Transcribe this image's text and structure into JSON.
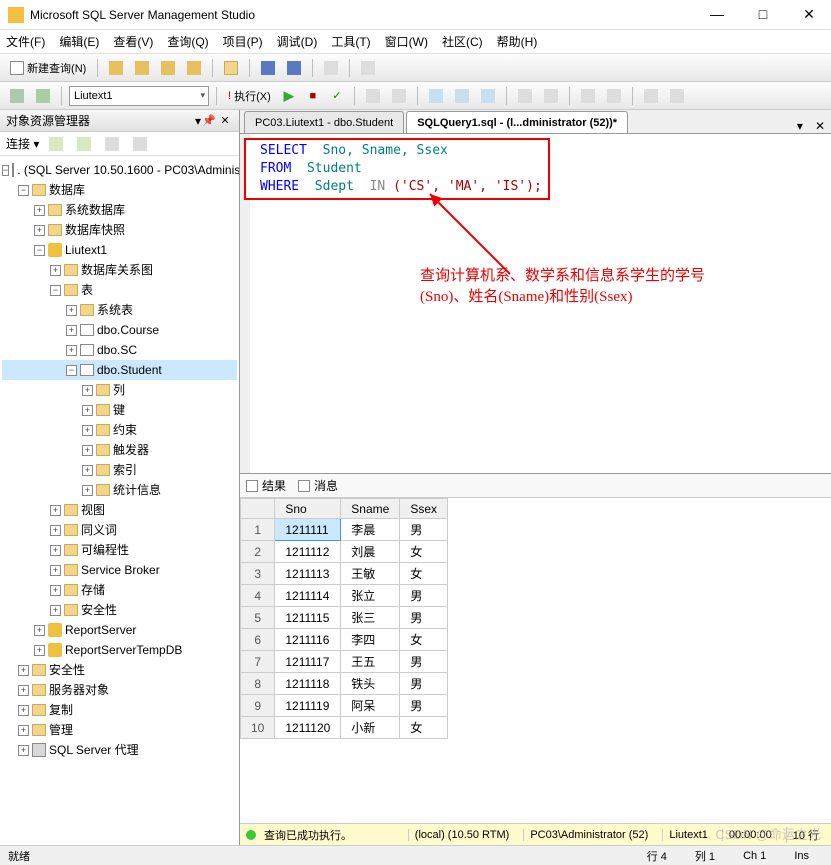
{
  "app": {
    "title": "Microsoft SQL Server Management Studio"
  },
  "menu": [
    "文件(F)",
    "编辑(E)",
    "查看(V)",
    "查询(Q)",
    "项目(P)",
    "调试(D)",
    "工具(T)",
    "窗口(W)",
    "社区(C)",
    "帮助(H)"
  ],
  "toolbar1": {
    "new_query": "新建查询(N)"
  },
  "toolbar2": {
    "db_combo": "Liutext1",
    "execute": "执行(X)"
  },
  "sidebar": {
    "title": "对象资源管理器",
    "connect_label": "连接 ▾",
    "root": ". (SQL Server 10.50.1600 - PC03\\Administ",
    "nodes": {
      "databases": "数据库",
      "sys_db": "系统数据库",
      "db_snap": "数据库快照",
      "liutext1": "Liutext1",
      "db_diagram": "数据库关系图",
      "tables": "表",
      "sys_tables": "系统表",
      "course": "dbo.Course",
      "sc": "dbo.SC",
      "student": "dbo.Student",
      "cols": "列",
      "keys": "键",
      "constraints": "约束",
      "triggers": "触发器",
      "indexes": "索引",
      "stats": "统计信息",
      "views": "视图",
      "synonyms": "同义词",
      "programmability": "可编程性",
      "service_broker": "Service Broker",
      "storage": "存储",
      "security_db": "安全性",
      "report_server": "ReportServer",
      "report_server_temp": "ReportServerTempDB",
      "security": "安全性",
      "server_objects": "服务器对象",
      "replication": "复制",
      "management": "管理",
      "sql_agent": "SQL Server 代理"
    }
  },
  "tabs": {
    "tab1": "PC03.Liutext1 - dbo.Student",
    "tab2": "SQLQuery1.sql - (l...dministrator (52))*"
  },
  "sql": {
    "select_kw": "SELECT",
    "select_cols": "Sno, Sname, Ssex",
    "from_kw": "FROM",
    "from_tbl": "Student",
    "where_kw": "WHERE",
    "where_col": "Sdept",
    "in_kw": "IN",
    "in_vals": "('CS', 'MA', 'IS');"
  },
  "annotation": {
    "line1": "查询计算机系、数学系和信息系学生的学号",
    "line2": "(Sno)、姓名(Sname)和性别(Ssex)"
  },
  "results": {
    "tab_results": "结果",
    "tab_messages": "消息",
    "headers": [
      "",
      "Sno",
      "Sname",
      "Ssex"
    ],
    "rows": [
      [
        "1",
        "1211111",
        "李晨",
        "男"
      ],
      [
        "2",
        "1211112",
        "刘晨",
        "女"
      ],
      [
        "3",
        "1211113",
        "王敏",
        "女"
      ],
      [
        "4",
        "1211114",
        "张立",
        "男"
      ],
      [
        "5",
        "1211115",
        "张三",
        "男"
      ],
      [
        "6",
        "1211116",
        "李四",
        "女"
      ],
      [
        "7",
        "1211117",
        "王五",
        "男"
      ],
      [
        "8",
        "1211118",
        "铁头",
        "男"
      ],
      [
        "9",
        "1211119",
        "阿呆",
        "男"
      ],
      [
        "10",
        "1211120",
        "小新",
        "女"
      ]
    ]
  },
  "exec_status": {
    "msg": "查询已成功执行。",
    "conn": "(local) (10.50 RTM)",
    "user": "PC03\\Administrator (52)",
    "db": "Liutext1",
    "time": "00:00:00",
    "rows": "10 行"
  },
  "statusbar": {
    "ready": "就绪",
    "line": "行 4",
    "col": "列 1",
    "ch": "Ch 1",
    "ins": "Ins"
  },
  "watermark": "CSDN @命运之光"
}
